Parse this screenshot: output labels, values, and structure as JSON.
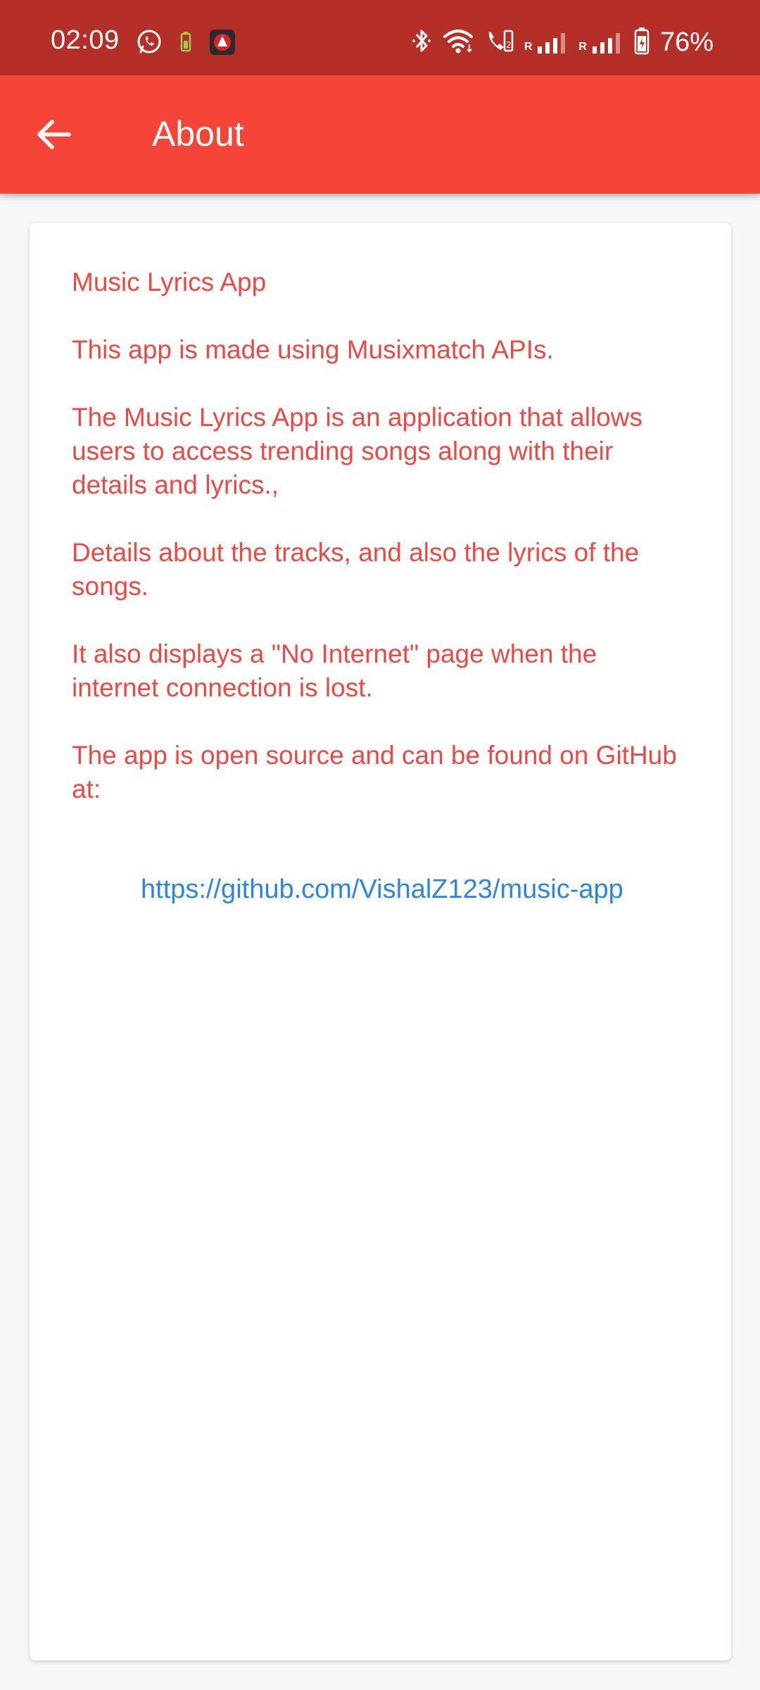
{
  "status_bar": {
    "time": "02:09",
    "battery": "76%",
    "icons": {
      "whatsapp": "whatsapp-icon",
      "battery_small": "battery-saver-icon",
      "app_notification": "app-notification-icon",
      "bluetooth": "bluetooth-icon",
      "wifi": "wifi-icon",
      "wifi_calling": "wifi-calling-icon",
      "signal1": "cell-signal-icon",
      "signal2": "cell-signal-icon",
      "battery": "battery-icon"
    },
    "roaming_1": "R",
    "roaming_2": "R"
  },
  "app_bar": {
    "title": "About",
    "back_icon": "arrow-back-icon"
  },
  "content": {
    "app_name": "Music Lyrics App",
    "api_note": "This app is made using Musixmatch APIs.",
    "description": "The Music Lyrics App is an application that allows users to access trending songs along with their details and lyrics.,",
    "details": "Details about the tracks, and also the lyrics of the songs.",
    "no_internet": "It also displays a \"No Internet\" page when the internet connection is lost.",
    "open_source": "The app is open source and can be found on GitHub at:",
    "github_link": "https://github.com/VishalZ123/music-app"
  },
  "colors": {
    "status_bar": "#b42f28",
    "app_bar": "#f44538",
    "text": "#e94a45",
    "link": "#2f86d8",
    "background": "#f7f7f7",
    "card": "#ffffff"
  }
}
